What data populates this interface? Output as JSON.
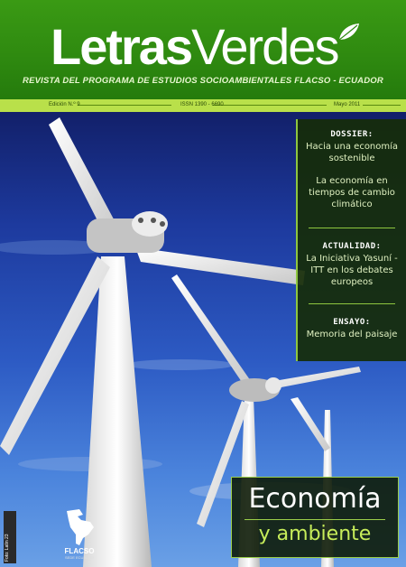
{
  "masthead": {
    "title_part1": "Letras",
    "title_part2": "Verdes",
    "subtitle": "REVISTA DEL PROGRAMA DE ESTUDIOS SOCIOAMBIENTALES FLACSO - ECUADOR"
  },
  "info_strip": {
    "edition": "Edición N.º 9",
    "issn": "ISSN 1390 - 6690",
    "date": "Mayo 2011"
  },
  "dossier": {
    "label": "DOSSIER:",
    "item1": "Hacia una economía sostenible",
    "item2": "La economía en tiempos de cambio climático"
  },
  "actualidad": {
    "label": "ACTUALIDAD:",
    "item1": "La Iniciativa Yasuní - ITT en los debates europeos"
  },
  "ensayo": {
    "label": "ENSAYO:",
    "item1": "Memoria del paisaje"
  },
  "cover_title": {
    "main": "Economía",
    "sub": "y ambiente"
  },
  "side_strip": {
    "text": "Foto: Latin 23"
  },
  "publisher": {
    "name": "FLACSO",
    "sub": "SEDE ECUADOR"
  },
  "colors": {
    "header_green": "#2f8a10",
    "accent_lime": "#b9e04a",
    "panel_dark": "#162c08",
    "sky_blue": "#2d5bc4"
  }
}
